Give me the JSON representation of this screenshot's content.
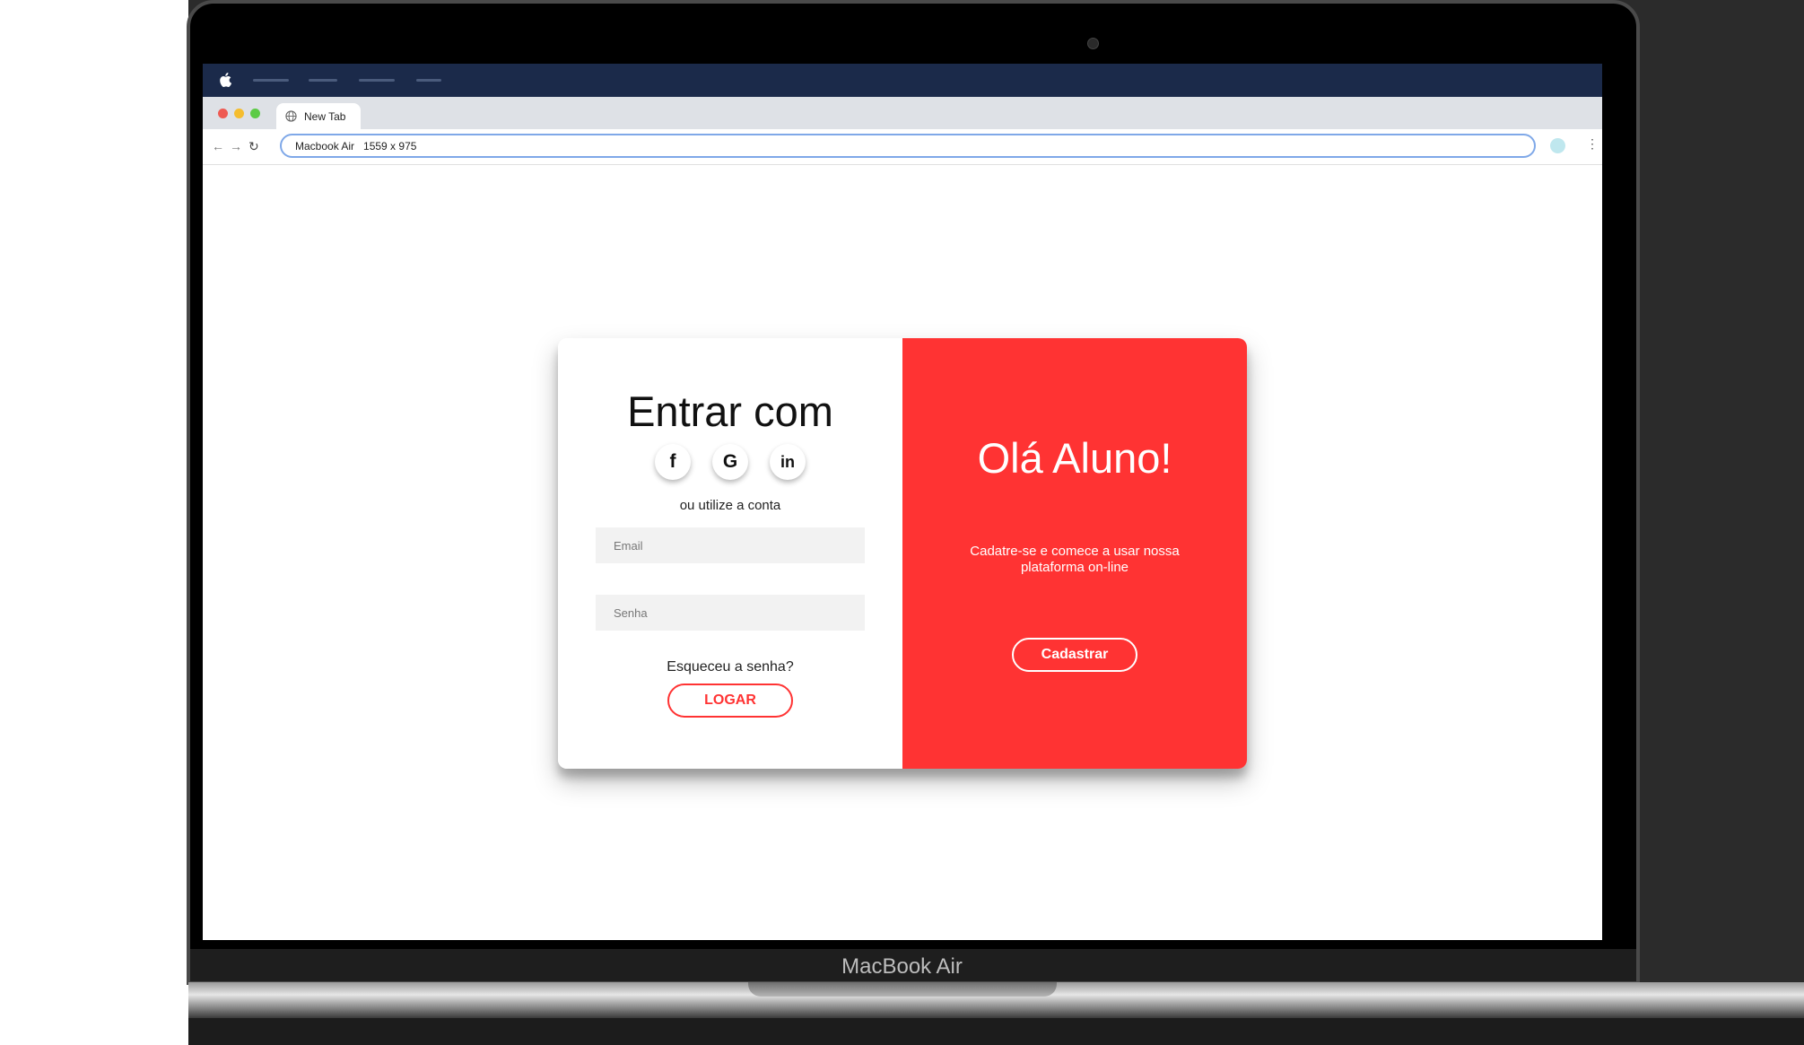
{
  "browser": {
    "tab_title": "New Tab",
    "address": "Macbook Air   1559 x 975"
  },
  "login": {
    "title": "Entrar com",
    "social": [
      {
        "name": "facebook",
        "glyph": "f"
      },
      {
        "name": "google",
        "glyph": "G"
      },
      {
        "name": "linkedin",
        "glyph": "in"
      }
    ],
    "alt_text": "ou utilize a conta",
    "email_placeholder": "Email",
    "password_placeholder": "Senha",
    "forgot": "Esqueceu a senha?",
    "submit": "LOGAR"
  },
  "signup": {
    "title": "Olá Aluno!",
    "text": "Cadatre-se e comece a usar nossa plataforma on-line",
    "button": "Cadastrar"
  },
  "device": {
    "brand": "MacBook Air"
  },
  "colors": {
    "accent": "#ff3333",
    "menubar": "#1b2a4a"
  }
}
